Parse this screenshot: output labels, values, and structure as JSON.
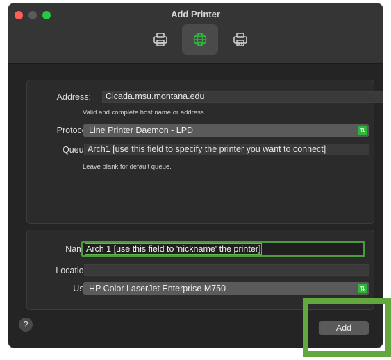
{
  "window": {
    "title": "Add Printer"
  },
  "toolbar": {
    "buttons": [
      {
        "name": "default",
        "icon": "printer-icon"
      },
      {
        "name": "ip",
        "icon": "globe-icon",
        "active": true
      },
      {
        "name": "windows",
        "icon": "printer-alt-icon"
      }
    ]
  },
  "connection": {
    "address_label": "Address:",
    "address_value": "Cicada.msu.montana.edu",
    "address_hint": "Valid and complete host name or address.",
    "protocol_label": "Protocol:",
    "protocol_value": "Line Printer Daemon - LPD",
    "queue_label": "Queue:",
    "queue_value": "Arch1 [use this field to specify the printer you want to connect]",
    "queue_hint": "Leave blank for default queue."
  },
  "details": {
    "name_label": "Name:",
    "name_value": "Arch 1 [use this field to 'nickname' the printer]",
    "location_label": "Location:",
    "location_value": "",
    "use_label": "Use:",
    "use_value": "HP Color LaserJet Enterprise M750"
  },
  "footer": {
    "help_label": "?",
    "add_label": "Add"
  },
  "colors": {
    "highlight": "#62a83f",
    "accent_green": "#2eb63a",
    "close": "#ff5f57",
    "zoom": "#28c840"
  }
}
